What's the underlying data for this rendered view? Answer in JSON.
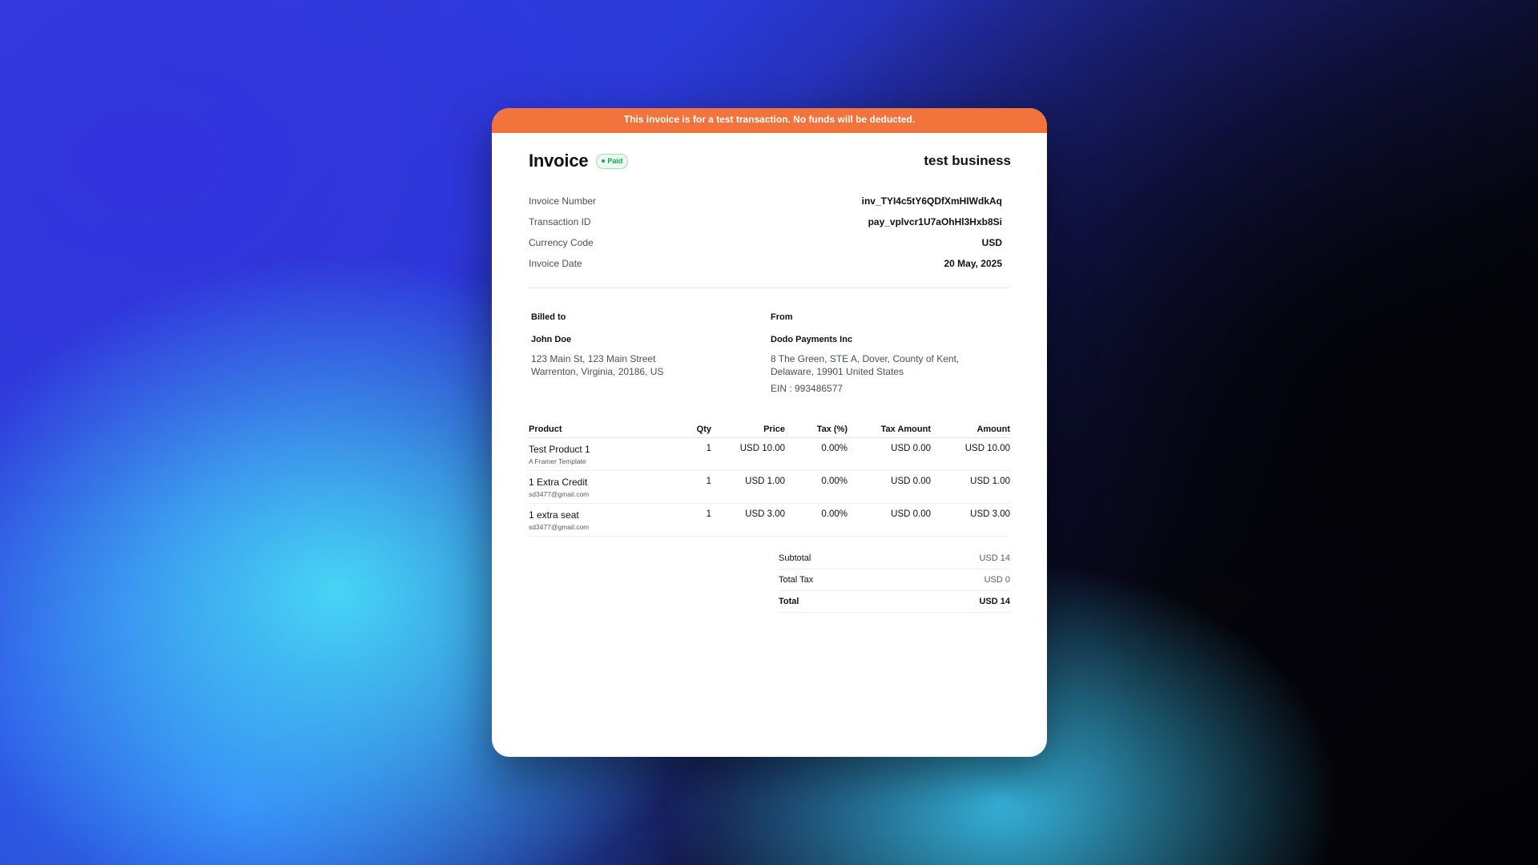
{
  "banner": {
    "text": "This invoice is for a test transaction. No funds will be deducted."
  },
  "header": {
    "title": "Invoice",
    "status_badge": "Paid",
    "business_name": "test business"
  },
  "meta": [
    {
      "label": "Invoice Number",
      "value": "inv_TYI4c5tY6QDfXmHIWdkAq"
    },
    {
      "label": "Transaction ID",
      "value": "pay_vplvcr1U7aOhHl3Hxb8Si"
    },
    {
      "label": "Currency Code",
      "value": "USD"
    },
    {
      "label": "Invoice Date",
      "value": "20 May, 2025"
    }
  ],
  "billed_to": {
    "heading": "Billed to",
    "name": "John Doe",
    "address_line1": "123 Main St, 123 Main Street",
    "address_line2": "Warrenton, Virginia, 20186, US"
  },
  "from": {
    "heading": "From",
    "name": "Dodo Payments Inc",
    "address_line1": "8 The Green, STE A, Dover, County of Kent,",
    "address_line2": "Delaware, 19901 United States",
    "ein": "EIN : 993486577"
  },
  "items_table": {
    "headers": [
      "Product",
      "Qty",
      "Price",
      "Tax (%)",
      "Tax Amount",
      "Amount"
    ],
    "rows": [
      {
        "product": "Test Product 1",
        "sub": "A Framer Template",
        "qty": "1",
        "price": "USD 10.00",
        "tax_pct": "0.00%",
        "tax_amount": "USD 0.00",
        "amount": "USD 10.00"
      },
      {
        "product": "1 Extra Credit",
        "sub": "sd3477@gmail.com",
        "qty": "1",
        "price": "USD 1.00",
        "tax_pct": "0.00%",
        "tax_amount": "USD 0.00",
        "amount": "USD 1.00"
      },
      {
        "product": "1 extra seat",
        "sub": "sd3477@gmail.com",
        "qty": "1",
        "price": "USD 3.00",
        "tax_pct": "0.00%",
        "tax_amount": "USD 0.00",
        "amount": "USD 3.00"
      }
    ]
  },
  "totals": [
    {
      "label": "Subtotal",
      "value": "USD 14"
    },
    {
      "label": "Total Tax",
      "value": "USD 0"
    },
    {
      "label": "Total",
      "value": "USD 14"
    }
  ],
  "colors": {
    "banner": "#f2733c",
    "paid_green": "#1fa352",
    "card": "#ffffff"
  }
}
